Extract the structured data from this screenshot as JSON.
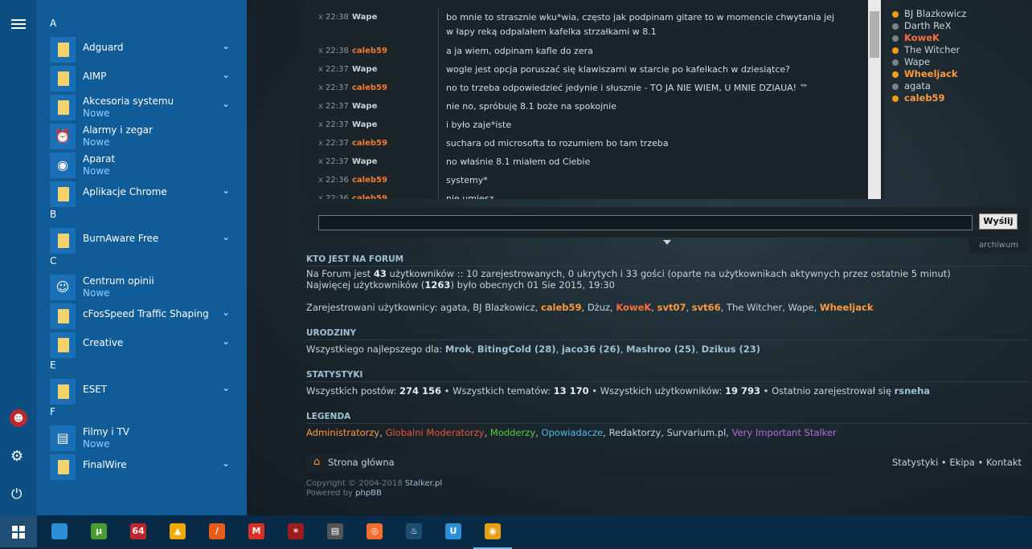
{
  "shoutbox": {
    "x_mark": "x",
    "messages": [
      {
        "time": "22:38",
        "user": "Wape",
        "color": "#c9d3d9",
        "text": "bo mnie to strasznie wku*wia, często jak podpinam gitare to w momencie chwytania jej"
      },
      {
        "time": "",
        "user": "",
        "color": "#c9d3d9",
        "text": "w łapy reką odpalałem kafelka strzałkami w 8.1"
      },
      {
        "time": "22:38",
        "user": "caleb59",
        "color": "#f57a32",
        "text": "a ja wiem, odpinam kafle do zera"
      },
      {
        "time": "22:37",
        "user": "Wape",
        "color": "#c9d3d9",
        "text": "wogle jest opcja poruszać się klawiszami w starcie po kafelkach w dziesiątce?"
      },
      {
        "time": "22:37",
        "user": "caleb59",
        "color": "#f57a32",
        "text": "no to trzeba odpowiedzieć jedynie i słusznie - TO JA NIE WIEM, U MNIE DZIAUA! ™"
      },
      {
        "time": "22:37",
        "user": "Wape",
        "color": "#c9d3d9",
        "text": "nie no, spróbuję 8.1 boże na spokojnie"
      },
      {
        "time": "22:37",
        "user": "Wape",
        "color": "#c9d3d9",
        "text": "i było zaje*iste"
      },
      {
        "time": "22:37",
        "user": "caleb59",
        "color": "#f57a32",
        "text": "suchara od microsofta to rozumiem bo tam trzeba"
      },
      {
        "time": "22:37",
        "user": "Wape",
        "color": "#c9d3d9",
        "text": "no właśnie 8.1 miałem od Ciebie"
      },
      {
        "time": "22:36",
        "user": "caleb59",
        "color": "#f57a32",
        "text": "systemy*"
      },
      {
        "time": "22:36",
        "user": "caleb59",
        "color": "#f57a32",
        "text": "nie umiesz"
      }
    ],
    "online": [
      {
        "name": "BJ Blazkowicz",
        "color": "#c9d3d9",
        "dot": "#f39c12",
        "bold": false
      },
      {
        "name": "Darth ReX",
        "color": "#c9d3d9",
        "dot": "#7a8388",
        "bold": false
      },
      {
        "name": "KoweK",
        "color": "#ff6e40",
        "dot": "#7a8388",
        "bold": true
      },
      {
        "name": "The Witcher",
        "color": "#c9d3d9",
        "dot": "#f39c12",
        "bold": false
      },
      {
        "name": "Wape",
        "color": "#c9d3d9",
        "dot": "#7a8388",
        "bold": false
      },
      {
        "name": "Wheeljack",
        "color": "#ff9a3c",
        "dot": "#f39c12",
        "bold": true
      },
      {
        "name": "agata",
        "color": "#c9d3d9",
        "dot": "#7a8388",
        "bold": false
      },
      {
        "name": "caleb59",
        "color": "#ff9a3c",
        "dot": "#f39c12",
        "bold": true
      }
    ],
    "send_label": "Wyślij",
    "archive_label": "archiwum",
    "input_value": ""
  },
  "who": {
    "title": "KTO JEST NA FORUM",
    "l1_a": "Na Forum jest ",
    "l1_b": "43",
    "l1_c": " użytkowników :: 10 zarejestrowanych, 0 ukrytych i 33 gości (oparte na użytkownikach aktywnych przez ostatnie 5 minut)",
    "l2_a": "Najwięcej użytkowników (",
    "l2_b": "1263",
    "l2_c": ") było obecnych 01 Sie 2015, 19:30",
    "reg_label": "Zarejestrowani użytkownicy: ",
    "users": [
      {
        "name": "agata",
        "color": "#c9d3d9",
        "bold": false
      },
      {
        "name": "BJ Blazkowicz",
        "color": "#c9d3d9",
        "bold": false
      },
      {
        "name": "caleb59",
        "color": "#ff9a3c",
        "bold": true
      },
      {
        "name": "Dżuz",
        "color": "#c9d3d9",
        "bold": false
      },
      {
        "name": "KoweK",
        "color": "#ff6e40",
        "bold": true
      },
      {
        "name": "svt07",
        "color": "#ff9a3c",
        "bold": true
      },
      {
        "name": "svt66",
        "color": "#ff9a3c",
        "bold": true
      },
      {
        "name": "The Witcher",
        "color": "#c9d3d9",
        "bold": false
      },
      {
        "name": "Wape",
        "color": "#c9d3d9",
        "bold": false
      },
      {
        "name": "Wheeljack",
        "color": "#ff9a3c",
        "bold": true
      }
    ]
  },
  "birthdays": {
    "title": "URODZINY",
    "label": "Wszystkiego najlepszego dla: ",
    "people": [
      "Mrok",
      "BitingCold (28)",
      "jaco36 (26)",
      "Mashroo (25)",
      "Dzikus (23)"
    ]
  },
  "stats": {
    "title": "STATYSTYKI",
    "a": "Wszystkich postów: ",
    "posts": "274 156",
    "b": " • Wszystkich tematów: ",
    "topics": "13 170",
    "c": " • Wszystkich użytkowników: ",
    "users": "19 793",
    "d": " • Ostatnio zarejestrował się ",
    "last": "rsneha"
  },
  "legend": {
    "title": "LEGENDA",
    "items": [
      {
        "name": "Administratorzy",
        "color": "#ff9a3c"
      },
      {
        "name": "Globalni Moderatorzy",
        "color": "#e6553a"
      },
      {
        "name": "Modderzy",
        "color": "#4fcf3a"
      },
      {
        "name": "Opowiadacze",
        "color": "#4fb8e6"
      },
      {
        "name": "Redaktorzy",
        "color": "#c9d3d9"
      },
      {
        "name": "Survarium.pl",
        "color": "#c9d3d9"
      },
      {
        "name": "Very Important Stalker",
        "color": "#b36bd8"
      }
    ]
  },
  "footer": {
    "home": "Strona główna",
    "links": [
      "Statystyki",
      "Ekipa",
      "Kontakt"
    ],
    "copyright_a": "Copyright © 2004-2018 ",
    "copyright_b": "Stalker.pl",
    "powered_a": "Powered by ",
    "powered_b": "phpBB"
  },
  "start_menu": {
    "groups": [
      {
        "letter": "A",
        "apps": [
          {
            "name": "Adguard",
            "sub": "",
            "chev": true,
            "icon": "folder"
          },
          {
            "name": "AIMP",
            "sub": "",
            "chev": true,
            "icon": "folder"
          },
          {
            "name": "Akcesoria systemu",
            "sub": "Nowe",
            "chev": true,
            "icon": "folder"
          },
          {
            "name": "Alarmy i zegar",
            "sub": "Nowe",
            "chev": false,
            "icon": "clock"
          },
          {
            "name": "Aparat",
            "sub": "Nowe",
            "chev": false,
            "icon": "camera"
          },
          {
            "name": "Aplikacje Chrome",
            "sub": "",
            "chev": true,
            "icon": "folder"
          }
        ]
      },
      {
        "letter": "B",
        "apps": [
          {
            "name": "BurnAware Free",
            "sub": "",
            "chev": true,
            "icon": "folder"
          }
        ]
      },
      {
        "letter": "C",
        "apps": [
          {
            "name": "Centrum opinii",
            "sub": "Nowe",
            "chev": false,
            "icon": "feedback"
          },
          {
            "name": "cFosSpeed Traffic Shaping",
            "sub": "",
            "chev": true,
            "icon": "folder"
          },
          {
            "name": "Creative",
            "sub": "",
            "chev": true,
            "icon": "folder"
          }
        ]
      },
      {
        "letter": "E",
        "apps": [
          {
            "name": "ESET",
            "sub": "",
            "chev": true,
            "icon": "folder"
          }
        ]
      },
      {
        "letter": "F",
        "apps": [
          {
            "name": "Filmy i TV",
            "sub": "Nowe",
            "chev": false,
            "icon": "film"
          },
          {
            "name": "FinalWire",
            "sub": "",
            "chev": true,
            "icon": "folder"
          }
        ]
      }
    ]
  },
  "taskbar": {
    "items": [
      {
        "name": "control-panel-icon",
        "color": "#2b8fd8",
        "label": ""
      },
      {
        "name": "utorrent-icon",
        "color": "#4a9d2f",
        "label": "µ"
      },
      {
        "name": "aida64-icon",
        "color": "#c0272d",
        "label": "64"
      },
      {
        "name": "aimp-icon",
        "color": "#f2a900",
        "label": "▲"
      },
      {
        "name": "pen-app-icon",
        "color": "#e65b1a",
        "label": "/"
      },
      {
        "name": "gmail-icon",
        "color": "#d93025",
        "label": "M"
      },
      {
        "name": "stalker-app-icon",
        "color": "#9e1b1b",
        "label": "✶"
      },
      {
        "name": "film-app-icon",
        "color": "#555",
        "label": "▤"
      },
      {
        "name": "origin-icon",
        "color": "#f56c2d",
        "label": "◎"
      },
      {
        "name": "steam-icon",
        "color": "#1b4f72",
        "label": "♨"
      },
      {
        "name": "uplay-icon",
        "color": "#2b8fd8",
        "label": "U"
      },
      {
        "name": "chrome-icon",
        "color": "#e8a010",
        "label": "◉"
      }
    ]
  }
}
